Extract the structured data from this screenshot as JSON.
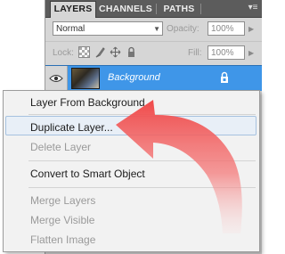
{
  "panel": {
    "tabs": [
      "LAYERS",
      "CHANNELS",
      "PATHS"
    ],
    "blend_mode": "Normal",
    "opacity_label": "Opacity:",
    "opacity_value": "100%",
    "lock_label": "Lock:",
    "fill_label": "Fill:",
    "fill_value": "100%",
    "layer_name": "Background"
  },
  "menu": {
    "items": [
      {
        "label": "Layer From Background...",
        "enabled": true
      },
      {
        "label": "Duplicate Layer...",
        "enabled": true,
        "highlighted": true
      },
      {
        "label": "Delete Layer",
        "enabled": false
      },
      {
        "label": "Convert to Smart Object",
        "enabled": true
      },
      {
        "label": "Merge Layers",
        "enabled": false
      },
      {
        "label": "Merge Visible",
        "enabled": false
      },
      {
        "label": "Flatten Image",
        "enabled": false
      }
    ]
  },
  "colors": {
    "selection": "#3f96e8",
    "arrow": "#f04a4a",
    "tabbar": "#5c5c5c"
  },
  "icons": [
    "panel-menu-icon",
    "chevron-down-icon",
    "checkerboard-lock-icon",
    "brush-lock-icon",
    "move-lock-icon",
    "padlock-icon",
    "eye-icon",
    "curved-arrow-icon"
  ]
}
